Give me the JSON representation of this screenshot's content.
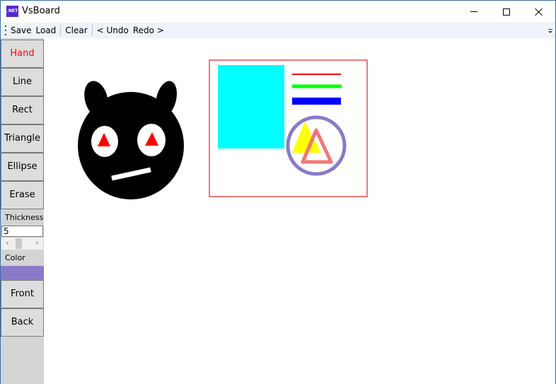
{
  "window": {
    "title": "VsBoard",
    "app_icon_text": ".NET",
    "app_icon_color": "#512bd4"
  },
  "toolbar": {
    "save": "Save",
    "load": "Load",
    "clear": "Clear",
    "undo": "< Undo",
    "redo": "Redo >"
  },
  "sidebar": {
    "tools": [
      "Hand",
      "Line",
      "Rect",
      "Triangle",
      "Ellipse",
      "Erase"
    ],
    "active_tool": "Hand",
    "active_color": "#ff0000",
    "thickness_label": "Thickness",
    "thickness_value": "5",
    "color_label": "Color",
    "color_value": "#8b7ac8",
    "front_label": "Front",
    "back_label": "Back"
  },
  "canvas": {
    "background": "#ffffff",
    "shapes": [
      {
        "kind": "character-head",
        "fill": "#000000"
      },
      {
        "kind": "eye",
        "fill": "#ffffff",
        "pupil": "#ff0000"
      },
      {
        "kind": "mouth",
        "fill": "#ffffff"
      },
      {
        "kind": "frame-rect",
        "stroke": "#f07878"
      },
      {
        "kind": "filled-rect",
        "fill": "#00ffff"
      },
      {
        "kind": "line",
        "stroke": "#ff0000"
      },
      {
        "kind": "line",
        "stroke": "#00ff00"
      },
      {
        "kind": "line",
        "stroke": "#0000ff"
      },
      {
        "kind": "ellipse",
        "stroke": "#8b7ac8"
      },
      {
        "kind": "filled-triangle",
        "fill": "#ffff00"
      },
      {
        "kind": "outline-triangle",
        "stroke": "#f07878"
      }
    ]
  }
}
